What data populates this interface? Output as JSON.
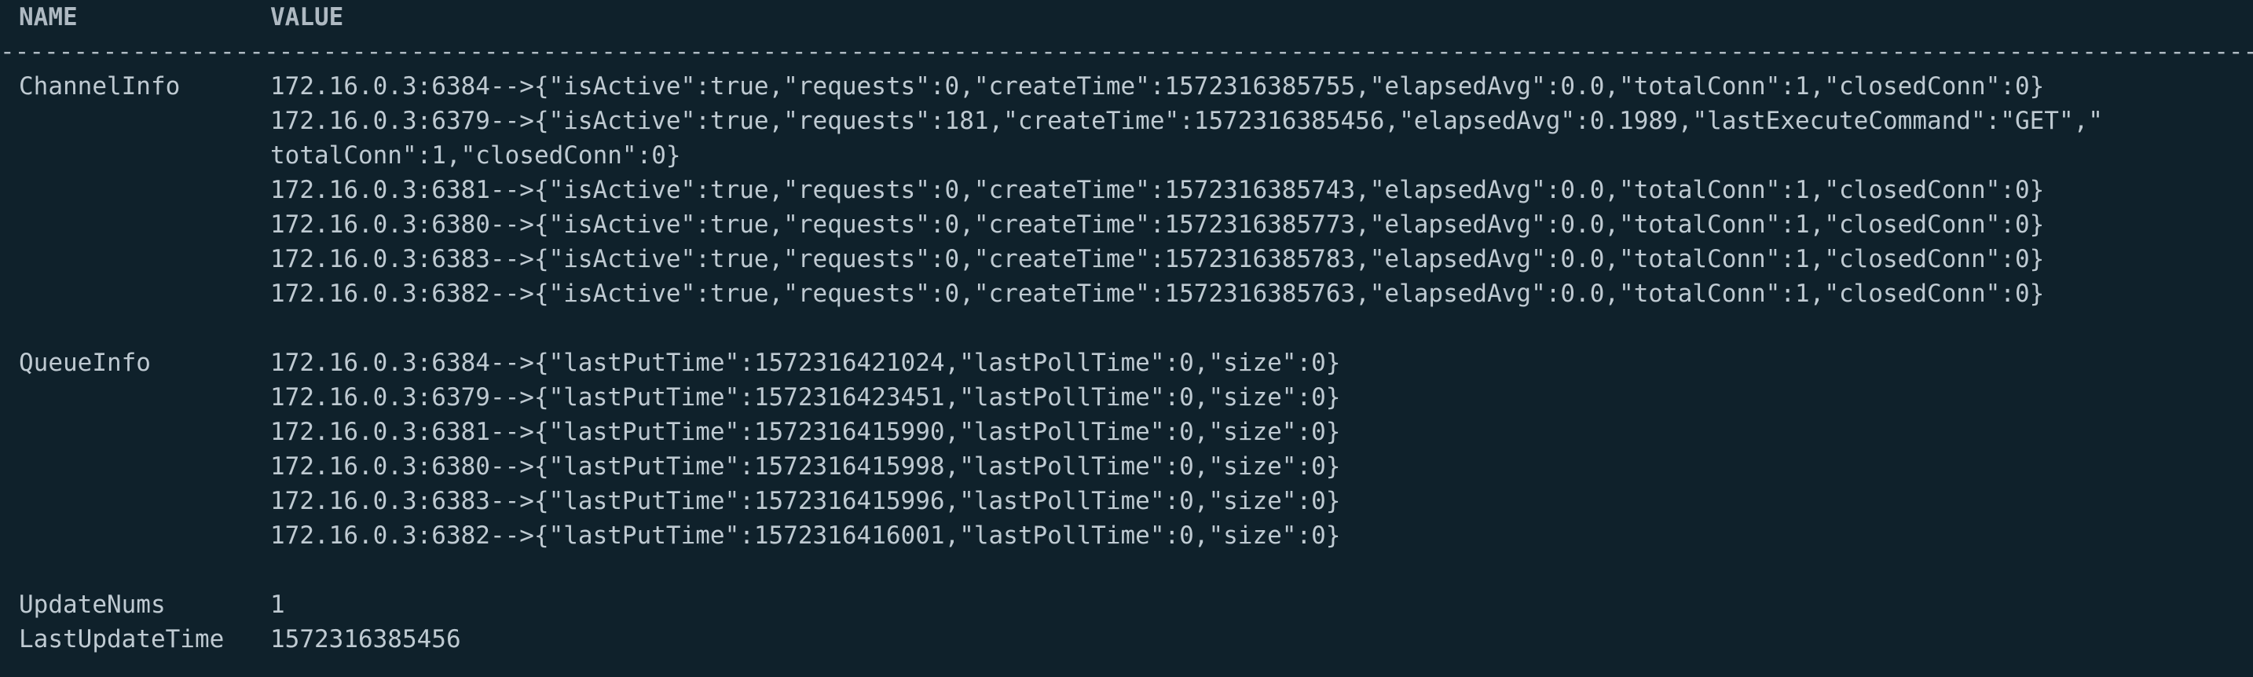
{
  "header": {
    "name_col": "NAME",
    "value_col": "VALUE"
  },
  "separator": "---------------------------------------------------------------------------------------------------------------------------------------------------------------------------------------------------------------------------------------------------------------------------------",
  "channel_info": {
    "name": "ChannelInfo",
    "lines": [
      "172.16.0.3:6384-->{\"isActive\":true,\"requests\":0,\"createTime\":1572316385755,\"elapsedAvg\":0.0,\"totalConn\":1,\"closedConn\":0}",
      "172.16.0.3:6379-->{\"isActive\":true,\"requests\":181,\"createTime\":1572316385456,\"elapsedAvg\":0.1989,\"lastExecuteCommand\":\"GET\",\"",
      "totalConn\":1,\"closedConn\":0}",
      "172.16.0.3:6381-->{\"isActive\":true,\"requests\":0,\"createTime\":1572316385743,\"elapsedAvg\":0.0,\"totalConn\":1,\"closedConn\":0}",
      "172.16.0.3:6380-->{\"isActive\":true,\"requests\":0,\"createTime\":1572316385773,\"elapsedAvg\":0.0,\"totalConn\":1,\"closedConn\":0}",
      "172.16.0.3:6383-->{\"isActive\":true,\"requests\":0,\"createTime\":1572316385783,\"elapsedAvg\":0.0,\"totalConn\":1,\"closedConn\":0}",
      "172.16.0.3:6382-->{\"isActive\":true,\"requests\":0,\"createTime\":1572316385763,\"elapsedAvg\":0.0,\"totalConn\":1,\"closedConn\":0}"
    ]
  },
  "queue_info": {
    "name": "QueueInfo",
    "lines": [
      "172.16.0.3:6384-->{\"lastPutTime\":1572316421024,\"lastPollTime\":0,\"size\":0}",
      "172.16.0.3:6379-->{\"lastPutTime\":1572316423451,\"lastPollTime\":0,\"size\":0}",
      "172.16.0.3:6381-->{\"lastPutTime\":1572316415990,\"lastPollTime\":0,\"size\":0}",
      "172.16.0.3:6380-->{\"lastPutTime\":1572316415998,\"lastPollTime\":0,\"size\":0}",
      "172.16.0.3:6383-->{\"lastPutTime\":1572316415996,\"lastPollTime\":0,\"size\":0}",
      "172.16.0.3:6382-->{\"lastPutTime\":1572316416001,\"lastPollTime\":0,\"size\":0}"
    ]
  },
  "update_nums": {
    "name": "UpdateNums",
    "value": "1"
  },
  "last_update_time": {
    "name": "LastUpdateTime",
    "value": "1572316385456"
  },
  "colors": {
    "background": "#0f212b",
    "text": "#bfcad2"
  }
}
